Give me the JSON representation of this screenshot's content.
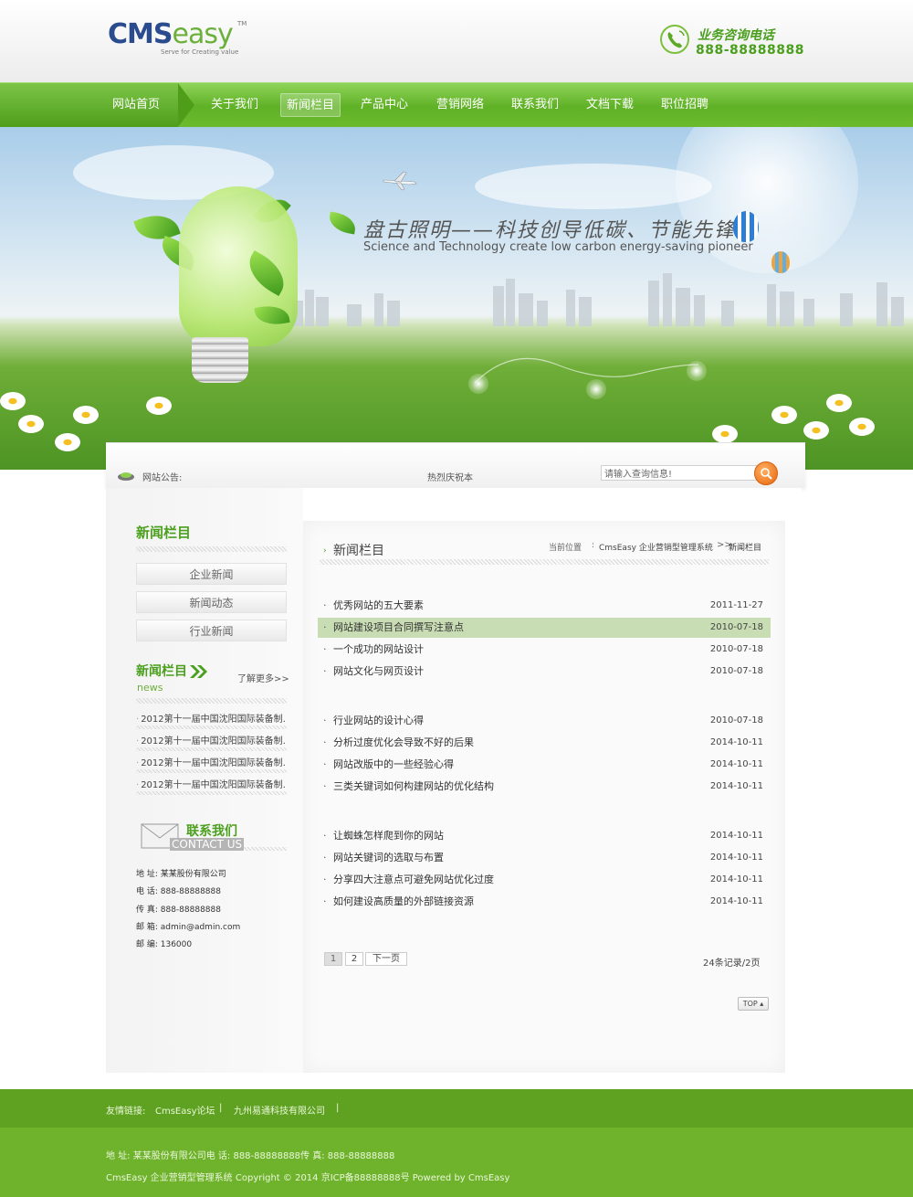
{
  "header": {
    "logo_cms": "CMS",
    "logo_easy": "easy",
    "logo_tm": "TM",
    "logo_slogan": "Serve for Creating value",
    "phone_label": "业务咨询电话",
    "phone_number": "888-88888888"
  },
  "nav": {
    "items": [
      "网站首页",
      "关于我们",
      "新闻栏目",
      "产品中心",
      "营销网络",
      "联系我们",
      "文档下载",
      "职位招聘"
    ],
    "active_index": 2
  },
  "banner": {
    "headline": "盘古照明——科技创导低碳、节能先锋",
    "subline": "Science and Technology create low carbon energy-saving pioneer"
  },
  "notice": {
    "label": "网站公告:",
    "text": "热烈庆祝本",
    "search_placeholder": "请输入查询信息!"
  },
  "sidebar": {
    "title": "新闻栏目",
    "categories": [
      "企业新闻",
      "新闻动态",
      "行业新闻"
    ],
    "news_title": "新闻栏目",
    "news_sub": "news",
    "more": "了解更多>>",
    "news_items": [
      "2012第十一届中国沈阳国际装备制…",
      "2012第十一届中国沈阳国际装备制…",
      "2012第十一届中国沈阳国际装备制…",
      "2012第十一届中国沈阳国际装备制…"
    ],
    "contact_title": "联系我们",
    "contact_en": "CONTACT US",
    "contact_lines": [
      "地 址: 某某股份有限公司",
      "电 话: 888-88888888",
      "传 真: 888-88888888",
      "邮 箱: admin@admin.com",
      "邮 编: 136000"
    ]
  },
  "content": {
    "title": "新闻栏目",
    "breadcrumb_label": "当前位置",
    "breadcrumb_sep": ":",
    "breadcrumb_site": "CmsEasy 企业营销型管理系统",
    "breadcrumb_arrow": ">>",
    "breadcrumb_current": "新闻栏目",
    "list_groups": [
      [
        {
          "title": "优秀网站的五大要素",
          "date": "2011-11-27"
        },
        {
          "title": "网站建设项目合同撰写注意点",
          "date": "2010-07-18",
          "highlight": true
        },
        {
          "title": "一个成功的网站设计",
          "date": "2010-07-18"
        },
        {
          "title": "网站文化与网页设计",
          "date": "2010-07-18"
        }
      ],
      [
        {
          "title": "行业网站的设计心得",
          "date": "2010-07-18"
        },
        {
          "title": "分析过度优化会导致不好的后果",
          "date": "2014-10-11"
        },
        {
          "title": "网站改版中的一些经验心得",
          "date": "2014-10-11"
        },
        {
          "title": "三类关键词如何构建网站的优化结构",
          "date": "2014-10-11"
        }
      ],
      [
        {
          "title": "让蜘蛛怎样爬到你的网站",
          "date": "2014-10-11"
        },
        {
          "title": "网站关键词的选取与布置",
          "date": "2014-10-11"
        },
        {
          "title": "分享四大注意点可避免网站优化过度",
          "date": "2014-10-11"
        },
        {
          "title": "如何建设高质量的外部链接资源",
          "date": "2014-10-11"
        }
      ]
    ],
    "pager": {
      "page1": "1",
      "page2": "2",
      "next": "下一页",
      "total": "24条记录/2页"
    },
    "top": "TOP"
  },
  "footer": {
    "links_label": "友情链接:",
    "link1": "CmsEasy论坛",
    "link2": "九州易通科技有限公司",
    "sep": "|",
    "address": "地 址: 某某股份有限公司电 话: 888-88888888传 真: 888-88888888",
    "copyright": "CmsEasy 企业营销型管理系统 Copyright © 2014 京ICP备88888888号 Powered by CmsEasy"
  }
}
